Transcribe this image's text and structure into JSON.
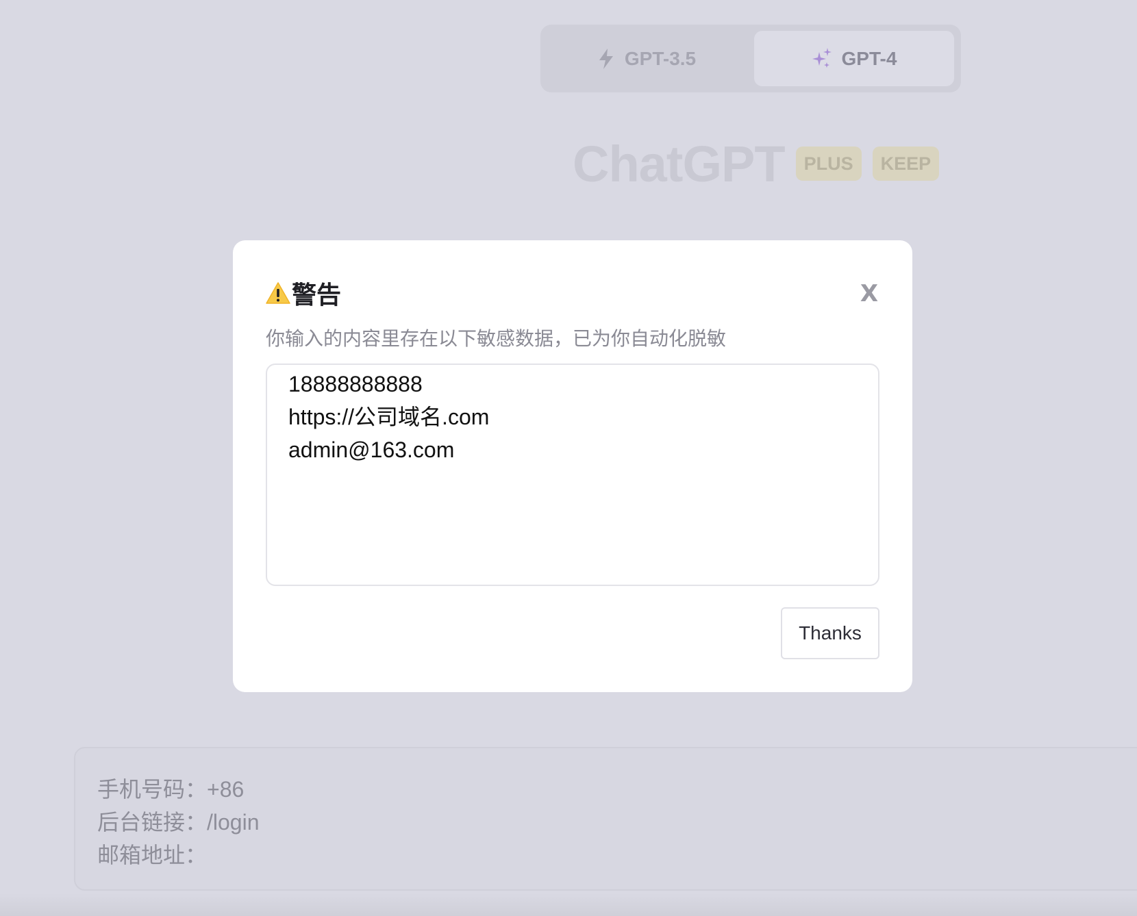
{
  "model_switch": {
    "tabs": [
      {
        "label": "GPT-3.5",
        "icon": "lightning-bolt-icon",
        "selected": false
      },
      {
        "label": "GPT-4",
        "icon": "sparkles-icon",
        "selected": true
      }
    ]
  },
  "brand": {
    "title": "ChatGPT",
    "badges": [
      "PLUS",
      "KEEP"
    ]
  },
  "modal": {
    "icon": "warning-icon",
    "title": "警告",
    "close_label": "X",
    "description": "你输入的内容里存在以下敏感数据，已为你自动化脱敏",
    "sensitive_items": [
      "18888888888",
      "https://公司域名.com",
      "admin@163.com"
    ],
    "confirm_label": "Thanks"
  },
  "input_area": {
    "lines": [
      "手机号码：+86",
      "后台链接：/login",
      "邮箱地址："
    ]
  },
  "colors": {
    "backdrop": "#d9d9e3",
    "modal_bg": "#ffffff",
    "badge_bg": "#d9d4bf",
    "warning": "#f7c948",
    "sparkle": "#a98fd6"
  }
}
